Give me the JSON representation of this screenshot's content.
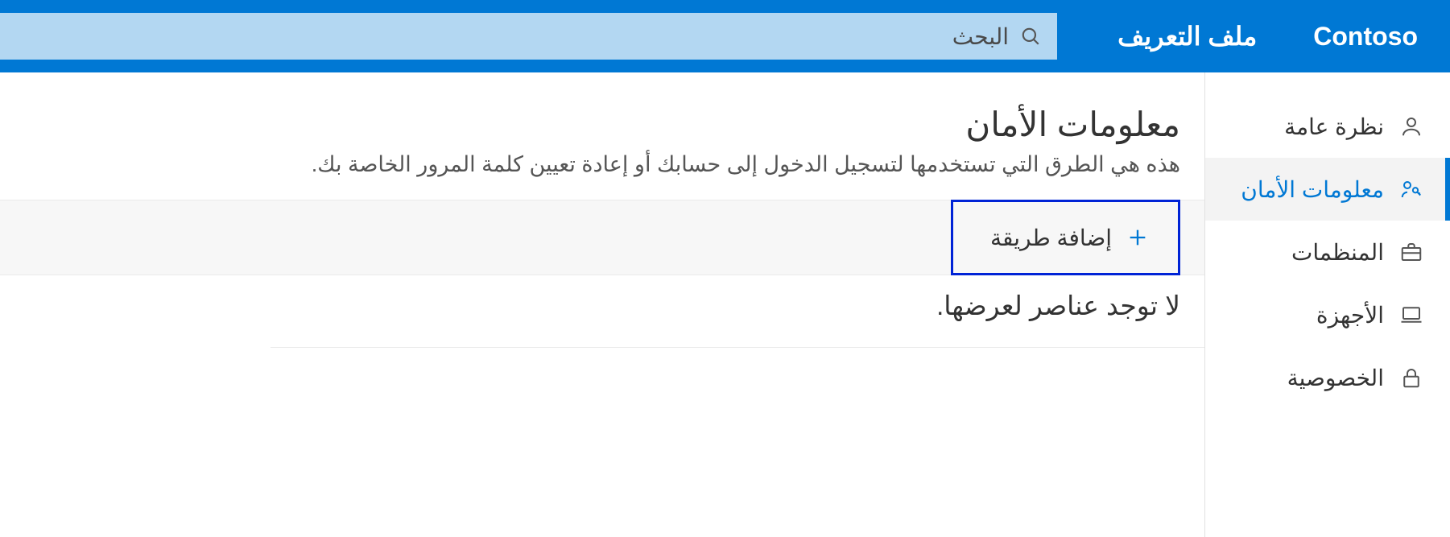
{
  "header": {
    "brand": "Contoso",
    "app_title": "ملف التعريف",
    "search_placeholder": "البحث"
  },
  "sidebar": {
    "items": [
      {
        "label": "نظرة عامة",
        "icon": "person"
      },
      {
        "label": "معلومات الأمان",
        "icon": "key-person"
      },
      {
        "label": "المنظمات",
        "icon": "briefcase"
      },
      {
        "label": "الأجهزة",
        "icon": "laptop"
      },
      {
        "label": "الخصوصية",
        "icon": "lock"
      }
    ]
  },
  "main": {
    "title": "معلومات الأمان",
    "subtitle": "هذه هي الطرق التي تستخدمها لتسجيل الدخول إلى حسابك أو إعادة تعيين كلمة المرور الخاصة بك.",
    "add_button": "إضافة طريقة",
    "empty": "لا توجد عناصر لعرضها."
  },
  "colors": {
    "primary": "#0078d4",
    "highlight_border": "#0023d6"
  }
}
